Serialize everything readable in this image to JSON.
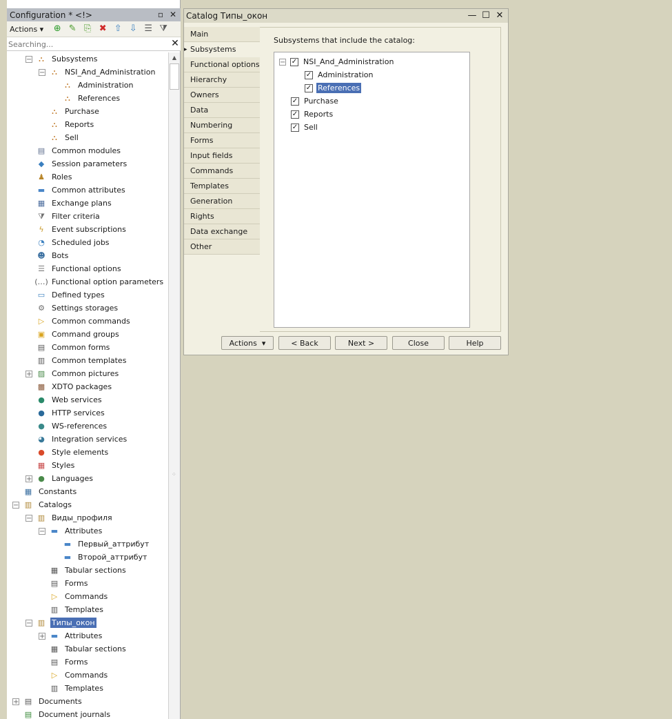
{
  "left_panel": {
    "title": "Configuration * <!>",
    "toolbar_actions": "Actions",
    "search_placeholder": "Searching...",
    "tree": [
      {
        "label": "Subsystems",
        "indent": 1,
        "exp": "minus",
        "icon": "subsystem-icon",
        "glyph": "⛬",
        "color": "#c07a2a"
      },
      {
        "label": "NSI_And_Administration",
        "indent": 2,
        "exp": "minus",
        "icon": "subsystem-icon",
        "glyph": "⛬",
        "color": "#c07a2a"
      },
      {
        "label": "Administration",
        "indent": 3,
        "exp": "none",
        "icon": "subsystem-icon",
        "glyph": "⛬",
        "color": "#c07a2a"
      },
      {
        "label": "References",
        "indent": 3,
        "exp": "none",
        "icon": "subsystem-icon",
        "glyph": "⛬",
        "color": "#c07a2a"
      },
      {
        "label": "Purchase",
        "indent": 2,
        "exp": "none",
        "icon": "subsystem-icon",
        "glyph": "⛬",
        "color": "#c07a2a"
      },
      {
        "label": "Reports",
        "indent": 2,
        "exp": "none",
        "icon": "subsystem-icon",
        "glyph": "⛬",
        "color": "#c07a2a"
      },
      {
        "label": "Sell",
        "indent": 2,
        "exp": "none",
        "icon": "subsystem-icon",
        "glyph": "⛬",
        "color": "#c07a2a"
      },
      {
        "label": "Common modules",
        "indent": 1,
        "exp": "none",
        "icon": "module-icon",
        "glyph": "▤",
        "color": "#5f6f8f"
      },
      {
        "label": "Session parameters",
        "indent": 1,
        "exp": "none",
        "icon": "session-parameter-icon",
        "glyph": "◆",
        "color": "#3a7fbf"
      },
      {
        "label": "Roles",
        "indent": 1,
        "exp": "none",
        "icon": "role-icon",
        "glyph": "♟",
        "color": "#b8862a"
      },
      {
        "label": "Common attributes",
        "indent": 1,
        "exp": "none",
        "icon": "attribute-icon",
        "glyph": "▬",
        "color": "#4a86c8"
      },
      {
        "label": "Exchange plans",
        "indent": 1,
        "exp": "none",
        "icon": "exchange-plan-icon",
        "glyph": "▦",
        "color": "#4f6f9f"
      },
      {
        "label": "Filter criteria",
        "indent": 1,
        "exp": "none",
        "icon": "filter-criteria-icon",
        "glyph": "⧩",
        "color": "#6f6f6f"
      },
      {
        "label": "Event subscriptions",
        "indent": 1,
        "exp": "none",
        "icon": "event-subscription-icon",
        "glyph": "ϟ",
        "color": "#c99a2a"
      },
      {
        "label": "Scheduled jobs",
        "indent": 1,
        "exp": "none",
        "icon": "scheduled-job-icon",
        "glyph": "◔",
        "color": "#3a7fbf"
      },
      {
        "label": "Bots",
        "indent": 1,
        "exp": "none",
        "icon": "bot-icon",
        "glyph": "☻",
        "color": "#3a6fa0"
      },
      {
        "label": "Functional options",
        "indent": 1,
        "exp": "none",
        "icon": "functional-option-icon",
        "glyph": "☰",
        "color": "#7a7a7a"
      },
      {
        "label": "Functional option parameters",
        "indent": 1,
        "exp": "none",
        "icon": "functional-option-parameter-icon",
        "glyph": "(…)",
        "color": "#5a5a5a"
      },
      {
        "label": "Defined types",
        "indent": 1,
        "exp": "none",
        "icon": "defined-type-icon",
        "glyph": "▭",
        "color": "#3a7fbf"
      },
      {
        "label": "Settings storages",
        "indent": 1,
        "exp": "none",
        "icon": "settings-storage-icon",
        "glyph": "⚙",
        "color": "#6f6f6f"
      },
      {
        "label": "Common commands",
        "indent": 1,
        "exp": "none",
        "icon": "command-icon",
        "glyph": "▷",
        "color": "#d9a520"
      },
      {
        "label": "Command groups",
        "indent": 1,
        "exp": "none",
        "icon": "command-group-icon",
        "glyph": "▣",
        "color": "#d9a520"
      },
      {
        "label": "Common forms",
        "indent": 1,
        "exp": "none",
        "icon": "form-icon",
        "glyph": "▤",
        "color": "#5a5a5a"
      },
      {
        "label": "Common templates",
        "indent": 1,
        "exp": "none",
        "icon": "template-icon",
        "glyph": "▥",
        "color": "#5a5a5a"
      },
      {
        "label": "Common pictures",
        "indent": 1,
        "exp": "plus",
        "icon": "picture-icon",
        "glyph": "▨",
        "color": "#4a8a4a"
      },
      {
        "label": "XDTO packages",
        "indent": 1,
        "exp": "none",
        "icon": "xdto-package-icon",
        "glyph": "▩",
        "color": "#8a5a3a"
      },
      {
        "label": "Web services",
        "indent": 1,
        "exp": "none",
        "icon": "web-service-icon",
        "glyph": "●",
        "color": "#2a8a6a"
      },
      {
        "label": "HTTP services",
        "indent": 1,
        "exp": "none",
        "icon": "http-service-icon",
        "glyph": "●",
        "color": "#2a6a9a"
      },
      {
        "label": "WS-references",
        "indent": 1,
        "exp": "none",
        "icon": "ws-reference-icon",
        "glyph": "●",
        "color": "#3a8a8a"
      },
      {
        "label": "Integration services",
        "indent": 1,
        "exp": "none",
        "icon": "integration-service-icon",
        "glyph": "◕",
        "color": "#3a7a9a"
      },
      {
        "label": "Style elements",
        "indent": 1,
        "exp": "none",
        "icon": "style-element-icon",
        "glyph": "●",
        "color": "#d94a2a"
      },
      {
        "label": "Styles",
        "indent": 1,
        "exp": "none",
        "icon": "style-icon",
        "glyph": "▦",
        "color": "#c84a4a"
      },
      {
        "label": "Languages",
        "indent": 1,
        "exp": "plus",
        "icon": "language-icon",
        "glyph": "●",
        "color": "#4a8a4a"
      },
      {
        "label": "Constants",
        "indent": 0,
        "exp": "none",
        "icon": "constant-icon",
        "glyph": "▦",
        "color": "#3a6fa0"
      },
      {
        "label": "Catalogs",
        "indent": 0,
        "exp": "minus",
        "icon": "catalog-icon",
        "glyph": "▥",
        "color": "#b08a3a"
      },
      {
        "label": "Виды_профиля",
        "indent": 1,
        "exp": "minus",
        "icon": "catalog-icon",
        "glyph": "▥",
        "color": "#b08a3a"
      },
      {
        "label": "Attributes",
        "indent": 2,
        "exp": "minus",
        "icon": "attribute-icon",
        "glyph": "▬",
        "color": "#4a86c8"
      },
      {
        "label": "Первый_аттрибут",
        "indent": 3,
        "exp": "none",
        "icon": "attribute-icon",
        "glyph": "▬",
        "color": "#4a86c8"
      },
      {
        "label": "Второй_аттрибут",
        "indent": 3,
        "exp": "none",
        "icon": "attribute-icon",
        "glyph": "▬",
        "color": "#4a86c8"
      },
      {
        "label": "Tabular sections",
        "indent": 2,
        "exp": "none",
        "icon": "tabular-section-icon",
        "glyph": "▦",
        "color": "#5a5a5a"
      },
      {
        "label": "Forms",
        "indent": 2,
        "exp": "none",
        "icon": "form-icon",
        "glyph": "▤",
        "color": "#5a5a5a"
      },
      {
        "label": "Commands",
        "indent": 2,
        "exp": "none",
        "icon": "command-icon",
        "glyph": "▷",
        "color": "#d9a520"
      },
      {
        "label": "Templates",
        "indent": 2,
        "exp": "none",
        "icon": "template-icon",
        "glyph": "▥",
        "color": "#5a5a5a"
      },
      {
        "label": "Типы_окон",
        "indent": 1,
        "exp": "minus",
        "icon": "catalog-icon",
        "glyph": "▥",
        "color": "#b08a3a",
        "selected": true
      },
      {
        "label": "Attributes",
        "indent": 2,
        "exp": "plus",
        "icon": "attribute-icon",
        "glyph": "▬",
        "color": "#4a86c8"
      },
      {
        "label": "Tabular sections",
        "indent": 2,
        "exp": "none",
        "icon": "tabular-section-icon",
        "glyph": "▦",
        "color": "#5a5a5a"
      },
      {
        "label": "Forms",
        "indent": 2,
        "exp": "none",
        "icon": "form-icon",
        "glyph": "▤",
        "color": "#5a5a5a"
      },
      {
        "label": "Commands",
        "indent": 2,
        "exp": "none",
        "icon": "command-icon",
        "glyph": "▷",
        "color": "#d9a520"
      },
      {
        "label": "Templates",
        "indent": 2,
        "exp": "none",
        "icon": "template-icon",
        "glyph": "▥",
        "color": "#5a5a5a"
      },
      {
        "label": "Documents",
        "indent": 0,
        "exp": "plus",
        "icon": "document-icon",
        "glyph": "▤",
        "color": "#5a5a5a"
      },
      {
        "label": "Document journals",
        "indent": 0,
        "exp": "none",
        "icon": "document-journal-icon",
        "glyph": "▤",
        "color": "#3a8a3a"
      }
    ]
  },
  "catalog_window": {
    "title": "Catalog Типы_окон",
    "tabs": [
      "Main",
      "Subsystems",
      "Functional options",
      "Hierarchy",
      "Owners",
      "Data",
      "Numbering",
      "Forms",
      "Input fields",
      "Commands",
      "Templates",
      "Generation",
      "Rights",
      "Data exchange",
      "Other"
    ],
    "active_tab": "Subsystems",
    "content_label": "Subsystems that include the catalog:",
    "subsystems": [
      {
        "label": "NSI_And_Administration",
        "level": 0,
        "exp": "minus",
        "checked": true
      },
      {
        "label": "Administration",
        "level": 1,
        "exp": "none",
        "checked": true
      },
      {
        "label": "References",
        "level": 1,
        "exp": "none",
        "checked": true,
        "selected": true
      },
      {
        "label": "Purchase",
        "level": 0,
        "exp": "none",
        "checked": true
      },
      {
        "label": "Reports",
        "level": 0,
        "exp": "none",
        "checked": true
      },
      {
        "label": "Sell",
        "level": 0,
        "exp": "none",
        "checked": true
      }
    ],
    "buttons": {
      "actions": "Actions",
      "back": "< Back",
      "next": "Next >",
      "close": "Close",
      "help": "Help"
    }
  }
}
